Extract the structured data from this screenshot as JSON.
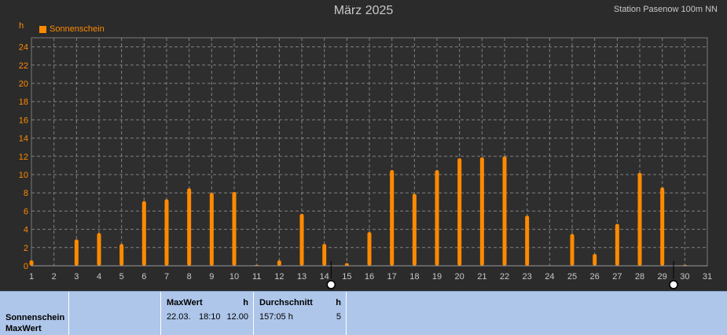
{
  "title": "März 2025",
  "station": "Station Pasenow 100m NN",
  "unit_label": "h",
  "colors": {
    "bar": "#ff8a00",
    "axis_text": "#ff8a00",
    "plot_bg": "#2e2e2e",
    "grid": "#808080",
    "panel_bg": "#aec6ea"
  },
  "chart_data": {
    "type": "bar",
    "title": "März 2025",
    "ylabel": "h",
    "ylim": [
      0,
      25
    ],
    "yticks": [
      0,
      2,
      4,
      6,
      8,
      10,
      12,
      14,
      16,
      18,
      20,
      22,
      24
    ],
    "xlim": [
      1,
      31
    ],
    "xticks": [
      1,
      2,
      3,
      4,
      5,
      6,
      7,
      8,
      9,
      10,
      11,
      12,
      13,
      14,
      15,
      16,
      17,
      18,
      19,
      20,
      21,
      22,
      23,
      24,
      25,
      26,
      27,
      28,
      29,
      30,
      31
    ],
    "grid": true,
    "legend_position": "top-left",
    "series": [
      {
        "name": "Sonnenschein",
        "x": [
          1,
          2,
          3,
          4,
          5,
          6,
          7,
          8,
          9,
          10,
          11,
          12,
          13,
          14,
          15,
          16,
          17,
          18,
          19,
          20,
          21,
          22,
          23,
          24,
          25,
          26,
          27,
          28,
          29,
          30
        ],
        "values": [
          0.6,
          0,
          2.9,
          3.6,
          2.4,
          7.1,
          7.3,
          8.5,
          8.0,
          8.1,
          0.1,
          0.6,
          5.7,
          2.4,
          0.3,
          3.7,
          10.5,
          7.9,
          10.5,
          11.8,
          11.9,
          12.0,
          5.5,
          0,
          3.5,
          1.3,
          4.6,
          10.2,
          8.6,
          0.1
        ]
      }
    ],
    "markers_x": [
      14.3,
      29.5
    ]
  },
  "info_panel": {
    "row_labels": [
      "Sonnenschein",
      "MaxWert"
    ],
    "maxwert": {
      "header": "MaxWert",
      "unit": "h",
      "date": "22.03.",
      "time": "18:10",
      "value": "12.00"
    },
    "durchschnitt": {
      "header": "Durchschnitt",
      "unit": "h",
      "value": "157:05 h",
      "count": "5"
    }
  }
}
